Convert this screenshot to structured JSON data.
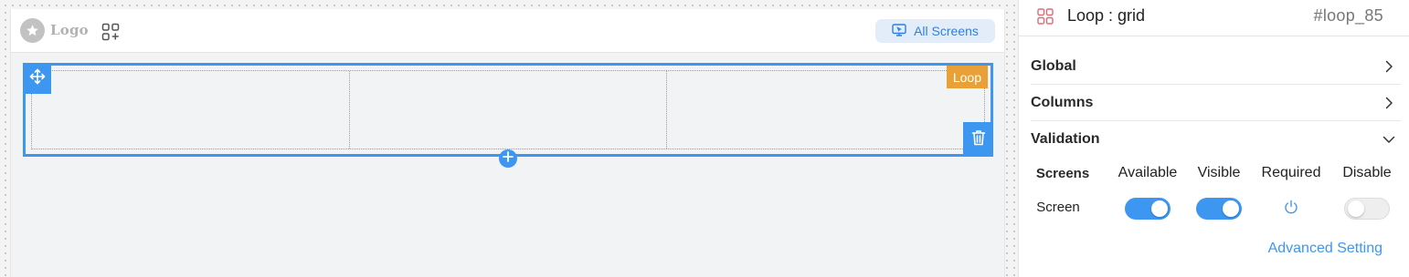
{
  "canvas": {
    "logo_text": "Logo",
    "all_screens_label": "All Screens"
  },
  "loop": {
    "tag_label": "Loop",
    "column_count": 3
  },
  "panel": {
    "title": "Loop : grid",
    "id": "#loop_85",
    "sections": [
      {
        "label": "Global",
        "state": "collapsed"
      },
      {
        "label": "Columns",
        "state": "collapsed"
      },
      {
        "label": "Validation",
        "state": "expanded"
      }
    ],
    "validation": {
      "headers": {
        "screens": "Screens",
        "available": "Available",
        "visible": "Visible",
        "required": "Required",
        "disable": "Disable"
      },
      "rows": [
        {
          "screen": "Screen",
          "available": true,
          "visible": true,
          "required": "power-icon",
          "disable": false
        }
      ]
    },
    "advanced_setting_label": "Advanced Setting"
  },
  "colors": {
    "accent": "#3d97f0",
    "loop_tag": "#e9a137",
    "panel_icon": "#e36a78"
  }
}
